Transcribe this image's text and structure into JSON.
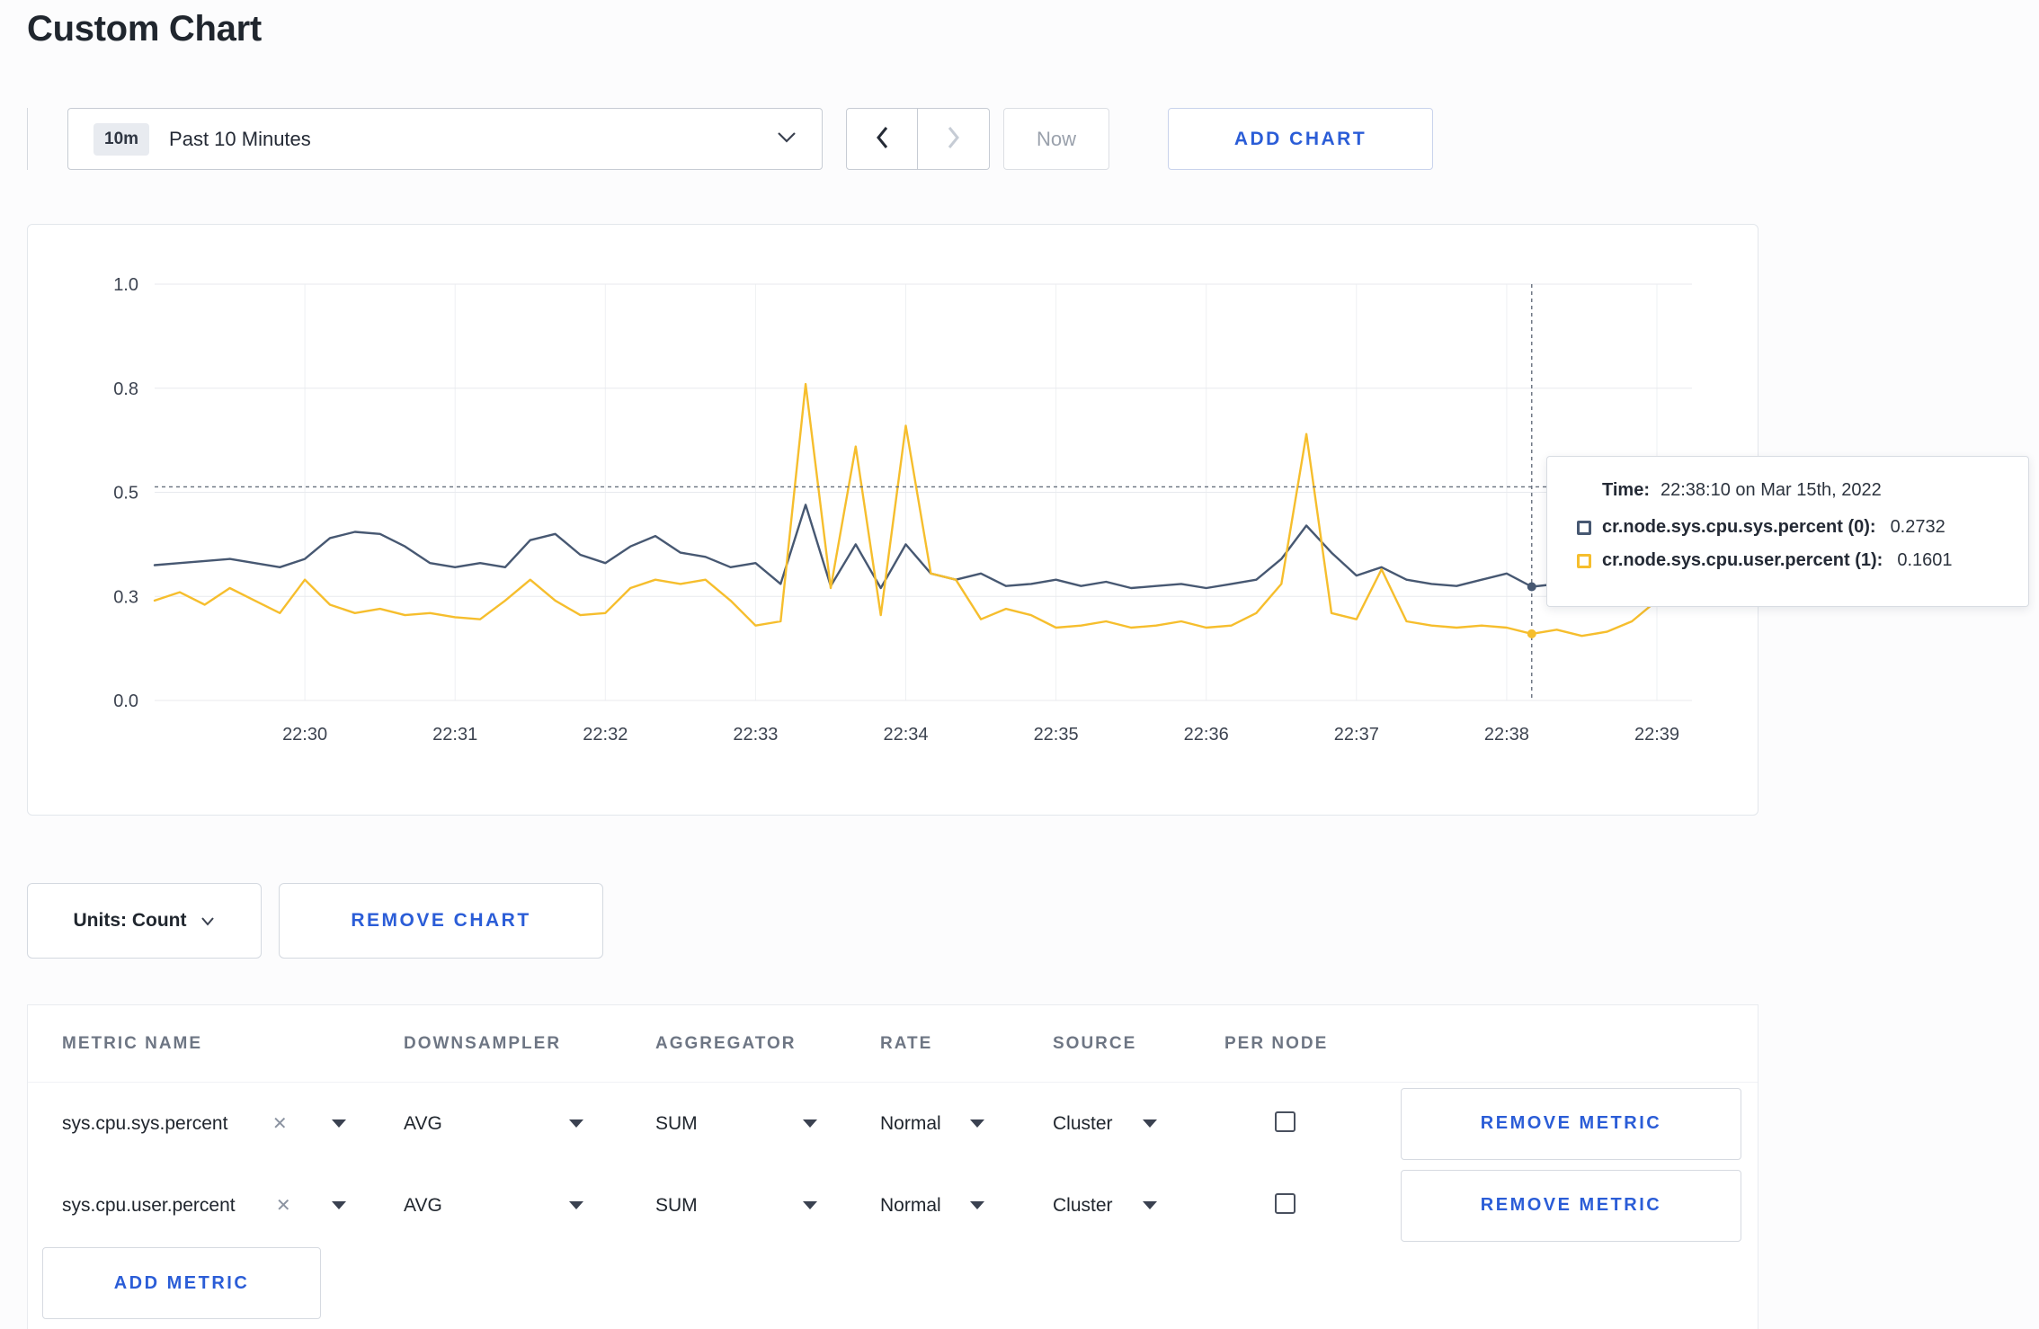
{
  "page": {
    "title": "Custom Chart"
  },
  "toolbar": {
    "time_range": {
      "badge": "10m",
      "label": "Past 10 Minutes"
    },
    "now_label": "Now",
    "add_chart_label": "ADD CHART"
  },
  "icons": {
    "clear": "✕"
  },
  "chart_data": {
    "type": "line",
    "title": "",
    "xlabel": "",
    "ylabel": "",
    "t_unit": "seconds after 22:29:00",
    "t_domain": [
      0,
      614
    ],
    "y_domain": [
      0,
      1
    ],
    "grid": true,
    "legend_position": "none",
    "x_ticks": [
      {
        "t": 60,
        "label": "22:30"
      },
      {
        "t": 120,
        "label": "22:31"
      },
      {
        "t": 180,
        "label": "22:32"
      },
      {
        "t": 240,
        "label": "22:33"
      },
      {
        "t": 300,
        "label": "22:34"
      },
      {
        "t": 360,
        "label": "22:35"
      },
      {
        "t": 420,
        "label": "22:36"
      },
      {
        "t": 480,
        "label": "22:37"
      },
      {
        "t": 540,
        "label": "22:38"
      },
      {
        "t": 600,
        "label": "22:39"
      }
    ],
    "y_ticks": [
      {
        "v": 0,
        "label": "0.0"
      },
      {
        "v": 0.25,
        "label": "0.3"
      },
      {
        "v": 0.5,
        "label": "0.5"
      },
      {
        "v": 0.75,
        "label": "0.8"
      },
      {
        "v": 1,
        "label": "1.0"
      }
    ],
    "series": [
      {
        "name": "cr.node.sys.cpu.sys.percent",
        "color": "#475872",
        "points": [
          [
            0,
            0.325
          ],
          [
            10,
            0.33
          ],
          [
            20,
            0.335
          ],
          [
            30,
            0.34
          ],
          [
            40,
            0.33
          ],
          [
            50,
            0.32
          ],
          [
            60,
            0.34
          ],
          [
            70,
            0.39
          ],
          [
            80,
            0.405
          ],
          [
            90,
            0.4
          ],
          [
            100,
            0.37
          ],
          [
            110,
            0.33
          ],
          [
            120,
            0.32
          ],
          [
            130,
            0.33
          ],
          [
            140,
            0.32
          ],
          [
            150,
            0.385
          ],
          [
            160,
            0.4
          ],
          [
            170,
            0.35
          ],
          [
            180,
            0.33
          ],
          [
            190,
            0.37
          ],
          [
            200,
            0.395
          ],
          [
            210,
            0.355
          ],
          [
            220,
            0.345
          ],
          [
            230,
            0.32
          ],
          [
            240,
            0.33
          ],
          [
            250,
            0.28
          ],
          [
            260,
            0.47
          ],
          [
            270,
            0.275
          ],
          [
            280,
            0.375
          ],
          [
            290,
            0.27
          ],
          [
            300,
            0.375
          ],
          [
            310,
            0.305
          ],
          [
            320,
            0.29
          ],
          [
            330,
            0.305
          ],
          [
            340,
            0.275
          ],
          [
            350,
            0.28
          ],
          [
            360,
            0.29
          ],
          [
            370,
            0.275
          ],
          [
            380,
            0.285
          ],
          [
            390,
            0.27
          ],
          [
            400,
            0.275
          ],
          [
            410,
            0.28
          ],
          [
            420,
            0.27
          ],
          [
            430,
            0.28
          ],
          [
            440,
            0.29
          ],
          [
            450,
            0.34
          ],
          [
            460,
            0.42
          ],
          [
            470,
            0.355
          ],
          [
            480,
            0.3
          ],
          [
            490,
            0.32
          ],
          [
            500,
            0.29
          ],
          [
            510,
            0.28
          ],
          [
            520,
            0.275
          ],
          [
            530,
            0.29
          ],
          [
            540,
            0.305
          ],
          [
            550,
            0.2732
          ],
          [
            560,
            0.28
          ],
          [
            570,
            0.29
          ],
          [
            580,
            0.305
          ],
          [
            590,
            0.29
          ],
          [
            600,
            0.28
          ],
          [
            610,
            0.29
          ]
        ]
      },
      {
        "name": "cr.node.sys.cpu.user.percent",
        "color": "#f6be2d",
        "points": [
          [
            0,
            0.24
          ],
          [
            10,
            0.26
          ],
          [
            20,
            0.23
          ],
          [
            30,
            0.27
          ],
          [
            40,
            0.24
          ],
          [
            50,
            0.21
          ],
          [
            60,
            0.29
          ],
          [
            70,
            0.23
          ],
          [
            80,
            0.21
          ],
          [
            90,
            0.22
          ],
          [
            100,
            0.205
          ],
          [
            110,
            0.21
          ],
          [
            120,
            0.2
          ],
          [
            130,
            0.195
          ],
          [
            140,
            0.24
          ],
          [
            150,
            0.29
          ],
          [
            160,
            0.24
          ],
          [
            170,
            0.205
          ],
          [
            180,
            0.21
          ],
          [
            190,
            0.27
          ],
          [
            200,
            0.29
          ],
          [
            210,
            0.28
          ],
          [
            220,
            0.29
          ],
          [
            230,
            0.24
          ],
          [
            240,
            0.18
          ],
          [
            250,
            0.19
          ],
          [
            260,
            0.76
          ],
          [
            270,
            0.27
          ],
          [
            280,
            0.61
          ],
          [
            290,
            0.205
          ],
          [
            300,
            0.66
          ],
          [
            310,
            0.305
          ],
          [
            320,
            0.29
          ],
          [
            330,
            0.195
          ],
          [
            340,
            0.22
          ],
          [
            350,
            0.205
          ],
          [
            360,
            0.175
          ],
          [
            370,
            0.18
          ],
          [
            380,
            0.19
          ],
          [
            390,
            0.175
          ],
          [
            400,
            0.18
          ],
          [
            410,
            0.19
          ],
          [
            420,
            0.175
          ],
          [
            430,
            0.18
          ],
          [
            440,
            0.21
          ],
          [
            450,
            0.28
          ],
          [
            460,
            0.64
          ],
          [
            470,
            0.21
          ],
          [
            480,
            0.195
          ],
          [
            490,
            0.315
          ],
          [
            500,
            0.19
          ],
          [
            510,
            0.18
          ],
          [
            520,
            0.175
          ],
          [
            530,
            0.18
          ],
          [
            540,
            0.175
          ],
          [
            550,
            0.1601
          ],
          [
            560,
            0.17
          ],
          [
            570,
            0.155
          ],
          [
            580,
            0.165
          ],
          [
            590,
            0.19
          ],
          [
            600,
            0.24
          ],
          [
            610,
            0.27
          ]
        ]
      }
    ],
    "crosshair": {
      "t": 550,
      "value_line": 0.513,
      "time": "22:38:10"
    },
    "hover_markers": [
      {
        "series": 0,
        "t": 550,
        "v": 0.2732
      },
      {
        "series": 1,
        "t": 550,
        "v": 0.1601
      }
    ]
  },
  "tooltip": {
    "time_label": "Time:",
    "time_value": "22:38:10 on Mar 15th, 2022",
    "rows": [
      {
        "name": "cr.node.sys.cpu.sys.percent (0):",
        "value": "0.2732",
        "color": "#475872"
      },
      {
        "name": "cr.node.sys.cpu.user.percent (1):",
        "value": "0.1601",
        "color": "#f6be2d"
      }
    ]
  },
  "controls": {
    "units_label": "Units: Count",
    "remove_chart_label": "REMOVE CHART",
    "remove_metric_label": "REMOVE METRIC",
    "add_metric_label": "ADD METRIC"
  },
  "table": {
    "headers": [
      "METRIC NAME",
      "DOWNSAMPLER",
      "AGGREGATOR",
      "RATE",
      "SOURCE",
      "PER NODE"
    ],
    "rows": [
      {
        "metric": "sys.cpu.sys.percent",
        "downsampler": "AVG",
        "aggregator": "SUM",
        "rate": "Normal",
        "source": "Cluster",
        "per_node": false
      },
      {
        "metric": "sys.cpu.user.percent",
        "downsampler": "AVG",
        "aggregator": "SUM",
        "rate": "Normal",
        "source": "Cluster",
        "per_node": false
      }
    ]
  }
}
